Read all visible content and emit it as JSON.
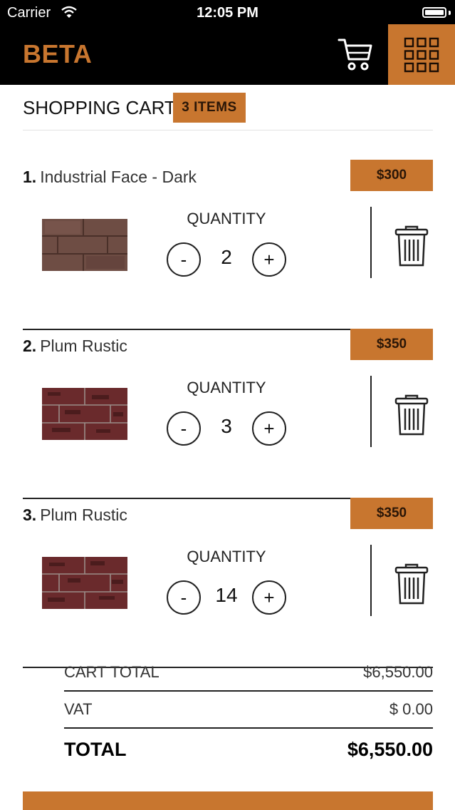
{
  "status_bar": {
    "carrier": "Carrier",
    "time": "12:05 PM"
  },
  "header": {
    "brand": "BETA",
    "cart_icon": "shopping-cart-icon",
    "menu_icon": "grid-menu-icon",
    "accent_color": "#c8762f"
  },
  "cart": {
    "title": "SHOPPING CART",
    "item_count_label": "3 ITEMS",
    "quantity_label": "QUANTITY",
    "minus_label": "-",
    "plus_label": "+",
    "items": [
      {
        "number": "1.",
        "name": "Industrial Face - Dark",
        "price": "$300",
        "quantity": "2"
      },
      {
        "number": "2.",
        "name": "Plum Rustic",
        "price": "$350",
        "quantity": "3"
      },
      {
        "number": "3.",
        "name": "Plum Rustic",
        "price": "$350",
        "quantity": "14"
      }
    ]
  },
  "totals": {
    "cart_total_label": "CART TOTAL",
    "cart_total_value": "$6,550.00",
    "vat_label": "VAT",
    "vat_value": "$ 0.00",
    "total_label": "TOTAL",
    "total_value": "$6,550.00"
  }
}
